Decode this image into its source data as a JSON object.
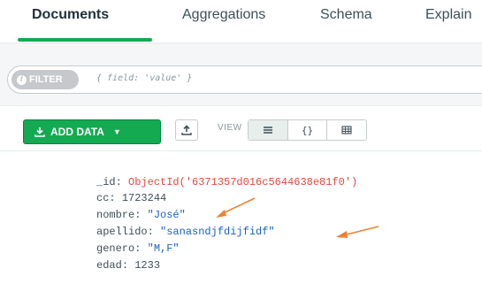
{
  "tabs": [
    {
      "label": "Documents",
      "active": true
    },
    {
      "label": "Aggregations",
      "active": false
    },
    {
      "label": "Schema",
      "active": false
    },
    {
      "label": "Explain",
      "active": false
    }
  ],
  "filter": {
    "pill_label": "FILTER",
    "info_glyph": "i",
    "placeholder": "{ field: 'value' }"
  },
  "toolbar": {
    "add_data_label": "ADD DATA",
    "add_data_icon": "download-icon",
    "view_label": "VIEW",
    "view_modes": [
      "list-icon",
      "json-icon",
      "table-icon"
    ]
  },
  "document": {
    "fields": [
      {
        "key": "_id",
        "value": "ObjectId('6371357d016c5644638e81f0')",
        "type": "oid"
      },
      {
        "key": "cc",
        "value": "1723244",
        "type": "num"
      },
      {
        "key": "nombre",
        "value": "\"José\"",
        "type": "str"
      },
      {
        "key": "apellido",
        "value": "\"sanasndjfdijfidf\"",
        "type": "str"
      },
      {
        "key": "genero",
        "value": "\"M,F\"",
        "type": "str"
      },
      {
        "key": "edad",
        "value": "1233",
        "type": "num"
      }
    ]
  },
  "colors": {
    "accent": "#13aa52",
    "annotation_arrow": "#f0822f",
    "objectid": "#e5483c",
    "string": "#1b5fc4"
  }
}
